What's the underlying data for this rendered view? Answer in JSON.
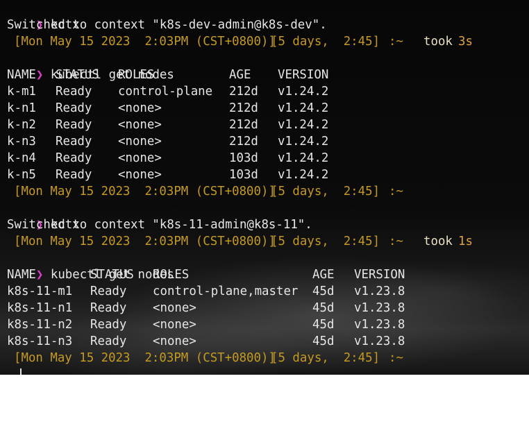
{
  "theme": {
    "background": "#070707",
    "foreground": "#e6e6e6",
    "prompt_color": "#e040c8",
    "info_color": "#c49a22",
    "took_color": "#e0a040"
  },
  "prompt": {
    "symbol": "❯",
    "symbol_icon": "chevron-right-icon"
  },
  "session1": {
    "cmd_kctx": "kctx",
    "switch_msg": "Switched to context \"k8s-dev-admin@k8s-dev\".",
    "status1": {
      "timestamp": "[Mon May 15 2023  2:03PM (CST+0800)]",
      "uptime": "[5 days,  2:45]",
      "path": ":~",
      "took_label": "took",
      "took_value": "3s"
    },
    "cmd_nodes": "kubectl get nodes",
    "table": {
      "headers": [
        "NAME",
        "STATUS",
        "ROLES",
        "AGE",
        "VERSION"
      ],
      "rows": [
        [
          "k-m1",
          "Ready",
          "control-plane",
          "212d",
          "v1.24.2"
        ],
        [
          "k-n1",
          "Ready",
          "<none>",
          "212d",
          "v1.24.2"
        ],
        [
          "k-n2",
          "Ready",
          "<none>",
          "212d",
          "v1.24.2"
        ],
        [
          "k-n3",
          "Ready",
          "<none>",
          "212d",
          "v1.24.2"
        ],
        [
          "k-n4",
          "Ready",
          "<none>",
          "103d",
          "v1.24.2"
        ],
        [
          "k-n5",
          "Ready",
          "<none>",
          "103d",
          "v1.24.2"
        ]
      ]
    },
    "status2": {
      "timestamp": "[Mon May 15 2023  2:03PM (CST+0800)]",
      "uptime": "[5 days,  2:45]",
      "path": ":~"
    }
  },
  "session2": {
    "cmd_kctx": "kctx",
    "switch_msg": "Switched to context \"k8s-11-admin@k8s-11\".",
    "status1": {
      "timestamp": "[Mon May 15 2023  2:03PM (CST+0800)]",
      "uptime": "[5 days,  2:45]",
      "path": ":~",
      "took_label": "took",
      "took_value": "1s"
    },
    "cmd_nodes": "kubectl get nodes",
    "table": {
      "headers": [
        "NAME",
        "STATUS",
        "ROLES",
        "AGE",
        "VERSION"
      ],
      "rows": [
        [
          "k8s-11-m1",
          "Ready",
          "control-plane,master",
          "45d",
          "v1.23.8"
        ],
        [
          "k8s-11-n1",
          "Ready",
          "<none>",
          "45d",
          "v1.23.8"
        ],
        [
          "k8s-11-n2",
          "Ready",
          "<none>",
          "45d",
          "v1.23.8"
        ],
        [
          "k8s-11-n3",
          "Ready",
          "<none>",
          "45d",
          "v1.23.8"
        ]
      ]
    },
    "status2": {
      "timestamp": "[Mon May 15 2023  2:03PM (CST+0800)]",
      "uptime": "[5 days,  2:45]",
      "path": ":~"
    }
  }
}
